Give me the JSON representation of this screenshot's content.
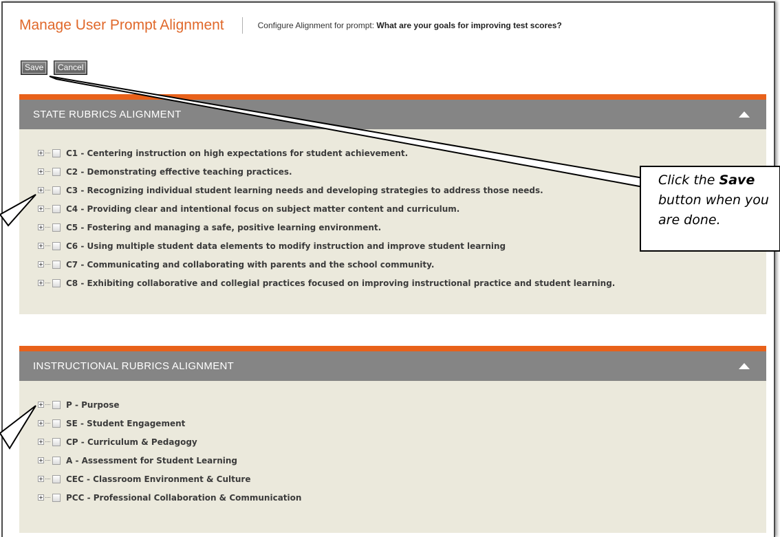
{
  "header": {
    "title": "Manage User Prompt Alignment",
    "prompt_label": "Configure Alignment for prompt:",
    "prompt_text": "What are your goals for improving test scores?"
  },
  "toolbar": {
    "save_label": "Save",
    "cancel_label": "Cancel"
  },
  "state_section": {
    "title": "STATE RUBRICS ALIGNMENT",
    "items": [
      "C1 - Centering instruction on high expectations for student achievement.",
      "C2 - Demonstrating effective teaching practices.",
      "C3 - Recognizing individual student learning needs and developing strategies to address those needs.",
      "C4 - Providing clear and intentional focus on subject matter content and curriculum.",
      "C5 - Fostering and managing a safe, positive learning environment.",
      "C6 - Using multiple student data elements to modify instruction and improve student learning",
      "C7 - Communicating and collaborating with parents and the school community.",
      "C8 - Exhibiting collaborative and collegial practices focused on improving instructional practice and student learning."
    ]
  },
  "instructional_section": {
    "title": "INSTRUCTIONAL RUBRICS ALIGNMENT",
    "items": [
      "P - Purpose",
      "SE - Student Engagement",
      "CP - Curriculum & Pedagogy",
      "A - Assessment for Student Learning",
      "CEC - Classroom Environment & Culture",
      "PCC - Professional Collaboration & Communication"
    ]
  },
  "callout": {
    "pre": "Click the",
    "bold": "Save",
    "post": "button when you are done."
  },
  "colors": {
    "accent": "#e8611a",
    "title": "#e0682a",
    "section_header": "#858585",
    "section_bg": "#ebe9dc"
  }
}
